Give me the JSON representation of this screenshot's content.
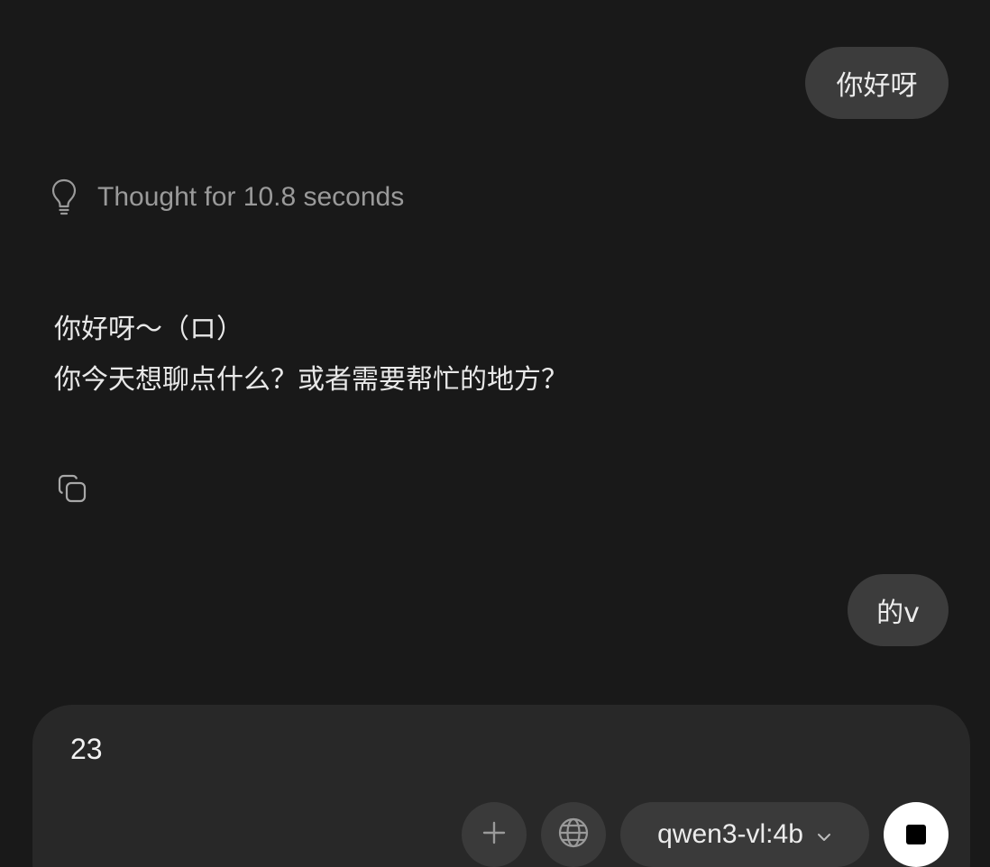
{
  "messages": {
    "user_1": "你好呀",
    "thought_label": "Thought for 10.8 seconds",
    "assistant_line_1": "你好呀～（ロ）",
    "assistant_line_2": "你今天想聊点什么？或者需要帮忙的地方？",
    "user_2": "的v"
  },
  "composer": {
    "input_value": "23",
    "model_name": "qwen3-vl:4b"
  },
  "icons": {
    "thought": "lightbulb-icon",
    "copy": "copy-icon",
    "attach": "plus-icon",
    "web_search": "globe-icon",
    "dropdown": "chevron-down-icon",
    "stop": "stop-icon"
  },
  "colors": {
    "background": "#191919",
    "bubble": "#3c3c3c",
    "composer": "#282828",
    "button": "#3a3a3a",
    "muted_text": "#9a9a9a",
    "stop_button": "#ffffff"
  }
}
